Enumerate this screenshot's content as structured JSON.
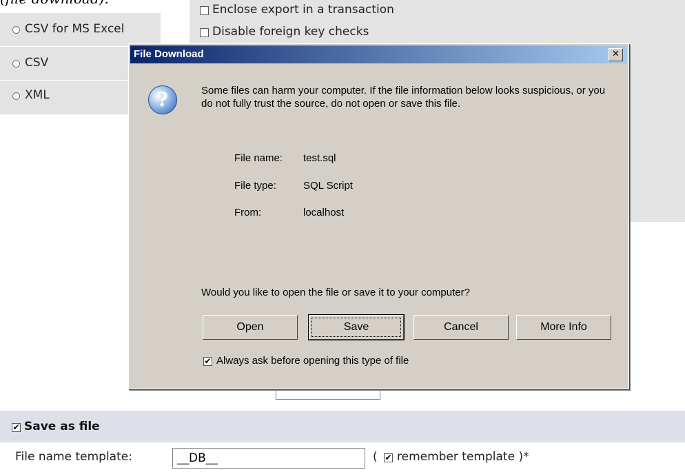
{
  "caption": "(file download).",
  "formats": [
    {
      "label": "CSV for MS Excel"
    },
    {
      "label": "CSV"
    },
    {
      "label": "XML"
    }
  ],
  "options": [
    {
      "label": "Enclose export in a transaction",
      "checked": false
    },
    {
      "label": "Disable foreign key checks",
      "checked": false
    }
  ],
  "dialog": {
    "title": "File Download",
    "close": "✕",
    "icon": "?",
    "warning": "Some files can harm your computer. If the file information below looks suspicious, or you do not fully trust the source, do not open or save this file.",
    "file_name_label": "File name:",
    "file_name": "test.sql",
    "file_type_label": "File type:",
    "file_type": "SQL Script",
    "from_label": "From:",
    "from": "localhost",
    "question": "Would you like to open the file or save it to your computer?",
    "buttons": {
      "open": "Open",
      "save": "Save",
      "cancel": "Cancel",
      "more_info": "More Info"
    },
    "always_ask": "Always ask before opening this type of file",
    "always_ask_checked": true
  },
  "save_as_file": {
    "label": "Save as file",
    "checked": true
  },
  "file_template": {
    "label": "File name template:",
    "value": "__DB__",
    "remember_open": "(",
    "remember_label": "remember template )*",
    "remember_checked": true
  },
  "icons": {
    "check": "✔"
  }
}
